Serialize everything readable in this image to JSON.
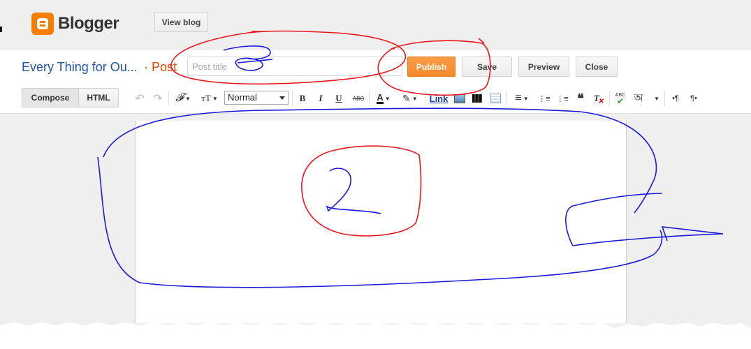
{
  "app": {
    "brand": "Blogger",
    "view_blog": "View blog"
  },
  "post": {
    "blog_name": "Every Thing for Ou...",
    "separator": "·",
    "post_label": "Post",
    "title_placeholder": "Post title",
    "title_value": ""
  },
  "actions": {
    "publish": "Publish",
    "save": "Save",
    "preview": "Preview",
    "close": "Close"
  },
  "toolbar": {
    "compose": "Compose",
    "html": "HTML",
    "undo": "↶",
    "redo": "↷",
    "font_icon": "𝓕",
    "text_size_icon": "тT",
    "format_value": "Normal",
    "bold": "B",
    "italic": "I",
    "underline": "U",
    "strikethrough": "ABC",
    "text_color": "A",
    "link": "Link",
    "align": "≡",
    "numbered_list": "⋮≡",
    "bulleted_list": "⋮≡",
    "quote": "❝",
    "remove_format": "T",
    "spellcheck": "ABC",
    "language": "অ",
    "ltr": "•¶",
    "rtl": "¶•"
  },
  "colors": {
    "brand": "#f57d00",
    "publish": "#f58a2d",
    "blog_name": "#2153a5",
    "post_label": "#dd4b00",
    "annotation_red": "#e8151b",
    "annotation_blue": "#1a1adb"
  },
  "annotations": {
    "number_2": "2",
    "number_3": "3"
  }
}
